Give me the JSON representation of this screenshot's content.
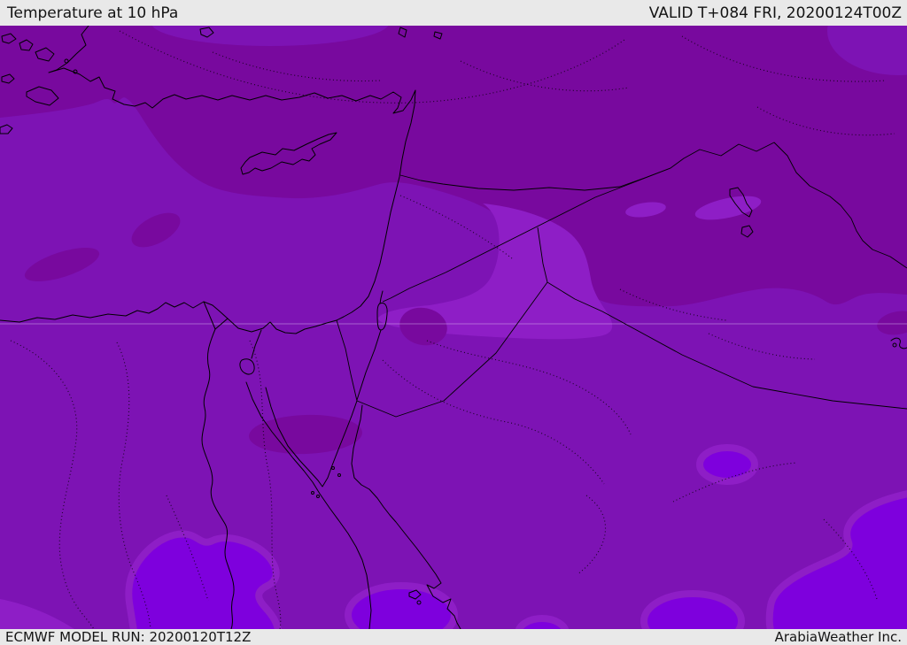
{
  "header": {
    "title": "Temperature at 10 hPa",
    "valid_label": "VALID T+084 FRI, 20200124T00Z"
  },
  "footer": {
    "model_run": "ECMWF MODEL RUN: 20200120T12Z",
    "brand": "ArabiaWeather Inc."
  },
  "map": {
    "colors": {
      "coldest": "#78099e",
      "cold": "#7d13b4",
      "mild": "#8e1ec6",
      "warmest": "#7e00dd",
      "line": "#000000",
      "bar_bg": "#e9e9e9",
      "bar_text": "#141414"
    }
  }
}
